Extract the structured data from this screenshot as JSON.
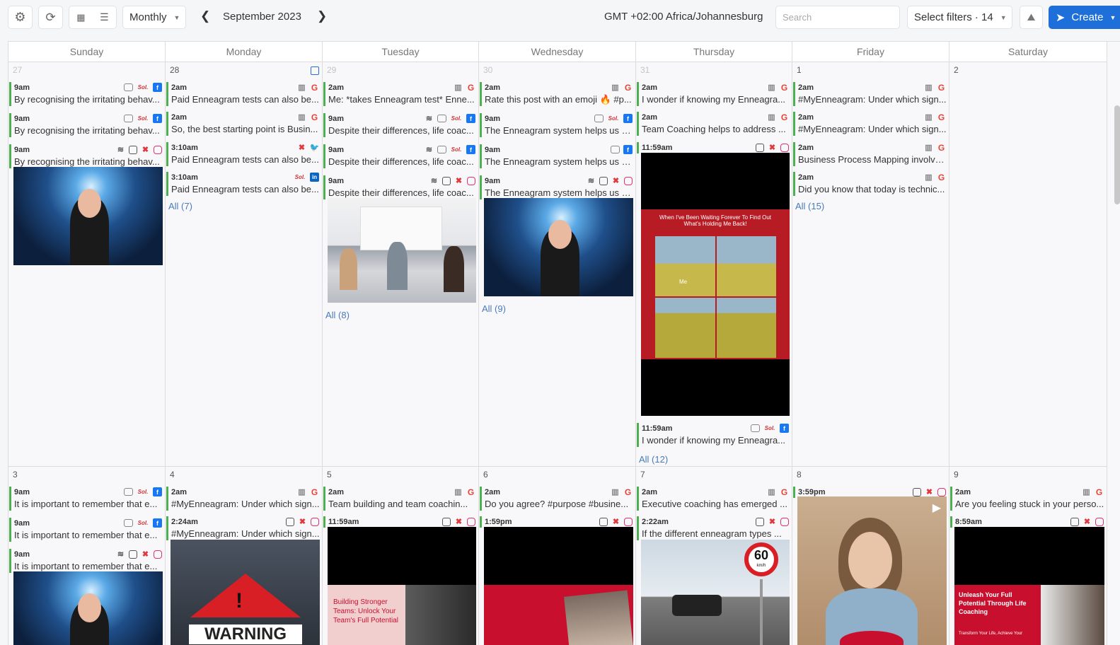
{
  "toolbar": {
    "view_label": "Monthly",
    "month_label": "September 2023",
    "timezone": "GMT +02:00 Africa/Johannesburg",
    "search_placeholder": "Search",
    "filters_label": "Select filters · 14",
    "create_label": "Create"
  },
  "days": [
    "Sunday",
    "Monday",
    "Tuesday",
    "Wednesday",
    "Thursday",
    "Friday",
    "Saturday"
  ],
  "week1": [
    {
      "num": "27",
      "muted": true,
      "posts": [
        {
          "time": "9am",
          "text": "By recognising the irritating behav...",
          "icons": [
            "cam",
            "logo",
            "fb"
          ]
        },
        {
          "time": "9am",
          "text": "By recognising the irritating behav...",
          "icons": [
            "cam",
            "logo",
            "fb"
          ]
        },
        {
          "time": "9am",
          "text": "By recognising the irritating behav...",
          "icons": [
            "lay",
            "reel",
            "red",
            "ig"
          ]
        }
      ],
      "all": ""
    },
    {
      "num": "28",
      "muted": false,
      "posts": [
        {
          "time": "2am",
          "text": "Paid Enneagram tests can also be...",
          "icons": [
            "bld",
            "g"
          ]
        },
        {
          "time": "2am",
          "text": "So, the best starting point is Busin...",
          "icons": [
            "bld",
            "g"
          ]
        },
        {
          "time": "3:10am",
          "text": "Paid Enneagram tests can also be...",
          "icons": [
            "red",
            "tw"
          ]
        },
        {
          "time": "3:10am",
          "text": "Paid Enneagram tests can also be...",
          "icons": [
            "logo",
            "li"
          ]
        }
      ],
      "all": "All (7)"
    },
    {
      "num": "29",
      "muted": true,
      "posts": [
        {
          "time": "2am",
          "text": "Me: *takes Enneagram test* Enne...",
          "icons": [
            "bld",
            "g"
          ]
        },
        {
          "time": "9am",
          "text": "Despite their differences, life coac...",
          "icons": [
            "lay",
            "cam",
            "logo",
            "fb"
          ]
        },
        {
          "time": "9am",
          "text": "Despite their differences, life coac...",
          "icons": [
            "lay",
            "cam",
            "logo",
            "fb"
          ]
        },
        {
          "time": "9am",
          "text": "Despite their differences, life coac...",
          "icons": [
            "lay",
            "reel",
            "red",
            "ig"
          ]
        }
      ],
      "all": "All (8)"
    },
    {
      "num": "30",
      "muted": true,
      "posts": [
        {
          "time": "2am",
          "text": "Rate this post with an emoji 🔥 #p...",
          "icons": [
            "bld",
            "g"
          ]
        },
        {
          "time": "9am",
          "text": "The Enneagram system helps us u...",
          "icons": [
            "cam",
            "logo",
            "fb"
          ]
        },
        {
          "time": "9am",
          "text": "The Enneagram system helps us u...",
          "icons": [
            "cam",
            "fb"
          ]
        },
        {
          "time": "9am",
          "text": "The Enneagram system helps us u...",
          "icons": [
            "lay",
            "reel",
            "red",
            "ig"
          ]
        }
      ],
      "all": "All (9)"
    },
    {
      "num": "31",
      "muted": true,
      "posts": [
        {
          "time": "2am",
          "text": "I wonder if knowing my Enneagra...",
          "icons": [
            "bld",
            "g"
          ]
        },
        {
          "time": "2am",
          "text": "Team Coaching helps to address ...",
          "icons": [
            "bld",
            "g"
          ]
        },
        {
          "time": "11:59am",
          "text": "",
          "icons": [
            "reel",
            "red",
            "ig"
          ]
        },
        {
          "time": "11:59am",
          "text": "I wonder if knowing my Enneagra...",
          "icons": [
            "cam",
            "logo",
            "fb"
          ]
        }
      ],
      "all": "All (12)"
    },
    {
      "num": "1",
      "muted": false,
      "posts": [
        {
          "time": "2am",
          "text": "#MyEnneagram: Under which sign...",
          "icons": [
            "bld",
            "g"
          ]
        },
        {
          "time": "2am",
          "text": "#MyEnneagram: Under which sign...",
          "icons": [
            "bld",
            "g"
          ]
        },
        {
          "time": "2am",
          "text": "Business Process Mapping involve...",
          "icons": [
            "bld",
            "g"
          ]
        },
        {
          "time": "2am",
          "text": "Did you know that today is technic...",
          "icons": [
            "bld",
            "g"
          ]
        }
      ],
      "all": "All (15)"
    },
    {
      "num": "2",
      "muted": false,
      "posts": [],
      "all": ""
    }
  ],
  "week2": [
    {
      "num": "3",
      "posts": [
        {
          "time": "9am",
          "text": "It is important to remember that e...",
          "icons": [
            "cam",
            "logo",
            "fb"
          ]
        },
        {
          "time": "9am",
          "text": "It is important to remember that e...",
          "icons": [
            "cam",
            "logo",
            "fb"
          ]
        },
        {
          "time": "9am",
          "text": "It is important to remember that e...",
          "icons": [
            "lay",
            "reel",
            "red",
            "ig"
          ]
        }
      ]
    },
    {
      "num": "4",
      "posts": [
        {
          "time": "2am",
          "text": "#MyEnneagram: Under which sign...",
          "icons": [
            "bld",
            "g"
          ]
        },
        {
          "time": "2:24am",
          "text": "#MyEnneagram: Under which sign...",
          "icons": [
            "reel",
            "red",
            "ig"
          ]
        }
      ]
    },
    {
      "num": "5",
      "posts": [
        {
          "time": "2am",
          "text": "Team building and team coachin...",
          "icons": [
            "bld",
            "g"
          ]
        },
        {
          "time": "11:59am",
          "text": "",
          "icons": [
            "reel",
            "red",
            "ig"
          ]
        }
      ]
    },
    {
      "num": "6",
      "posts": [
        {
          "time": "2am",
          "text": "Do you agree? #purpose #busine...",
          "icons": [
            "bld",
            "g"
          ]
        },
        {
          "time": "1:59pm",
          "text": "",
          "icons": [
            "reel",
            "red",
            "ig"
          ]
        }
      ]
    },
    {
      "num": "7",
      "posts": [
        {
          "time": "2am",
          "text": "Executive coaching has emerged ...",
          "icons": [
            "bld",
            "g"
          ]
        },
        {
          "time": "2:22am",
          "text": "If the different enneagram types ...",
          "icons": [
            "reel",
            "red",
            "ig"
          ]
        }
      ]
    },
    {
      "num": "8",
      "posts": [
        {
          "time": "3:59pm",
          "text": "",
          "icons": [
            "reel",
            "red",
            "ig"
          ]
        }
      ]
    },
    {
      "num": "9",
      "posts": [
        {
          "time": "2am",
          "text": "Are you feeling stuck in your perso...",
          "icons": [
            "bld",
            "g"
          ]
        },
        {
          "time": "8:59am",
          "text": "",
          "icons": [
            "reel",
            "red",
            "ig"
          ]
        }
      ]
    }
  ],
  "media_text": {
    "meme_caption": "When I've Been Waiting Forever To Find Out What's Holding Me Back!",
    "meme_label": "Me",
    "warning": "WARNING",
    "teams": "Building Stronger Teams: Unlock Your Team's Full Potential",
    "speed": "60",
    "speed_unit": "km/h",
    "unleash": "Unleash Your Full Potential Through Life Coaching",
    "unleash_sub": "Transform Your Life, Achieve Your"
  },
  "colors": {
    "accent": "#1e6fd9",
    "post_bar": "#4caf50",
    "brand_red": "#c8102e"
  }
}
